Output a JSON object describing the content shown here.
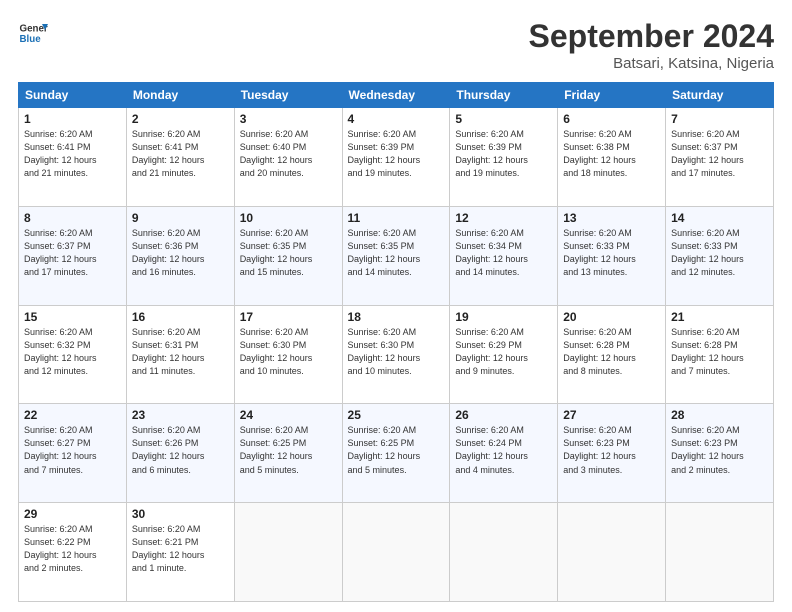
{
  "logo": {
    "line1": "General",
    "line2": "Blue"
  },
  "title": "September 2024",
  "subtitle": "Batsari, Katsina, Nigeria",
  "weekdays": [
    "Sunday",
    "Monday",
    "Tuesday",
    "Wednesday",
    "Thursday",
    "Friday",
    "Saturday"
  ],
  "weeks": [
    [
      {
        "day": "1",
        "info": "Sunrise: 6:20 AM\nSunset: 6:41 PM\nDaylight: 12 hours\nand 21 minutes."
      },
      {
        "day": "2",
        "info": "Sunrise: 6:20 AM\nSunset: 6:41 PM\nDaylight: 12 hours\nand 21 minutes."
      },
      {
        "day": "3",
        "info": "Sunrise: 6:20 AM\nSunset: 6:40 PM\nDaylight: 12 hours\nand 20 minutes."
      },
      {
        "day": "4",
        "info": "Sunrise: 6:20 AM\nSunset: 6:39 PM\nDaylight: 12 hours\nand 19 minutes."
      },
      {
        "day": "5",
        "info": "Sunrise: 6:20 AM\nSunset: 6:39 PM\nDaylight: 12 hours\nand 19 minutes."
      },
      {
        "day": "6",
        "info": "Sunrise: 6:20 AM\nSunset: 6:38 PM\nDaylight: 12 hours\nand 18 minutes."
      },
      {
        "day": "7",
        "info": "Sunrise: 6:20 AM\nSunset: 6:37 PM\nDaylight: 12 hours\nand 17 minutes."
      }
    ],
    [
      {
        "day": "8",
        "info": "Sunrise: 6:20 AM\nSunset: 6:37 PM\nDaylight: 12 hours\nand 17 minutes."
      },
      {
        "day": "9",
        "info": "Sunrise: 6:20 AM\nSunset: 6:36 PM\nDaylight: 12 hours\nand 16 minutes."
      },
      {
        "day": "10",
        "info": "Sunrise: 6:20 AM\nSunset: 6:35 PM\nDaylight: 12 hours\nand 15 minutes."
      },
      {
        "day": "11",
        "info": "Sunrise: 6:20 AM\nSunset: 6:35 PM\nDaylight: 12 hours\nand 14 minutes."
      },
      {
        "day": "12",
        "info": "Sunrise: 6:20 AM\nSunset: 6:34 PM\nDaylight: 12 hours\nand 14 minutes."
      },
      {
        "day": "13",
        "info": "Sunrise: 6:20 AM\nSunset: 6:33 PM\nDaylight: 12 hours\nand 13 minutes."
      },
      {
        "day": "14",
        "info": "Sunrise: 6:20 AM\nSunset: 6:33 PM\nDaylight: 12 hours\nand 12 minutes."
      }
    ],
    [
      {
        "day": "15",
        "info": "Sunrise: 6:20 AM\nSunset: 6:32 PM\nDaylight: 12 hours\nand 12 minutes."
      },
      {
        "day": "16",
        "info": "Sunrise: 6:20 AM\nSunset: 6:31 PM\nDaylight: 12 hours\nand 11 minutes."
      },
      {
        "day": "17",
        "info": "Sunrise: 6:20 AM\nSunset: 6:30 PM\nDaylight: 12 hours\nand 10 minutes."
      },
      {
        "day": "18",
        "info": "Sunrise: 6:20 AM\nSunset: 6:30 PM\nDaylight: 12 hours\nand 10 minutes."
      },
      {
        "day": "19",
        "info": "Sunrise: 6:20 AM\nSunset: 6:29 PM\nDaylight: 12 hours\nand 9 minutes."
      },
      {
        "day": "20",
        "info": "Sunrise: 6:20 AM\nSunset: 6:28 PM\nDaylight: 12 hours\nand 8 minutes."
      },
      {
        "day": "21",
        "info": "Sunrise: 6:20 AM\nSunset: 6:28 PM\nDaylight: 12 hours\nand 7 minutes."
      }
    ],
    [
      {
        "day": "22",
        "info": "Sunrise: 6:20 AM\nSunset: 6:27 PM\nDaylight: 12 hours\nand 7 minutes."
      },
      {
        "day": "23",
        "info": "Sunrise: 6:20 AM\nSunset: 6:26 PM\nDaylight: 12 hours\nand 6 minutes."
      },
      {
        "day": "24",
        "info": "Sunrise: 6:20 AM\nSunset: 6:25 PM\nDaylight: 12 hours\nand 5 minutes."
      },
      {
        "day": "25",
        "info": "Sunrise: 6:20 AM\nSunset: 6:25 PM\nDaylight: 12 hours\nand 5 minutes."
      },
      {
        "day": "26",
        "info": "Sunrise: 6:20 AM\nSunset: 6:24 PM\nDaylight: 12 hours\nand 4 minutes."
      },
      {
        "day": "27",
        "info": "Sunrise: 6:20 AM\nSunset: 6:23 PM\nDaylight: 12 hours\nand 3 minutes."
      },
      {
        "day": "28",
        "info": "Sunrise: 6:20 AM\nSunset: 6:23 PM\nDaylight: 12 hours\nand 2 minutes."
      }
    ],
    [
      {
        "day": "29",
        "info": "Sunrise: 6:20 AM\nSunset: 6:22 PM\nDaylight: 12 hours\nand 2 minutes."
      },
      {
        "day": "30",
        "info": "Sunrise: 6:20 AM\nSunset: 6:21 PM\nDaylight: 12 hours\nand 1 minute."
      },
      null,
      null,
      null,
      null,
      null
    ]
  ]
}
